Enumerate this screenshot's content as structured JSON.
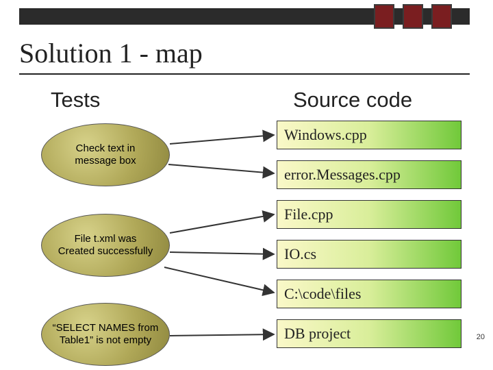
{
  "title": "Solution 1 - map",
  "columns": {
    "left": "Tests",
    "right": "Source code"
  },
  "tests": [
    {
      "label": "Check text in\nmessage box"
    },
    {
      "label": "File t.xml was\nCreated successfully"
    },
    {
      "label": "“SELECT NAMES from\nTable1” is not empty"
    }
  ],
  "sources": [
    "Windows.cpp",
    "error.Messages.cpp",
    "File.cpp",
    "IO.cs",
    "C:\\code\\files",
    "DB project"
  ],
  "page_number": "20"
}
